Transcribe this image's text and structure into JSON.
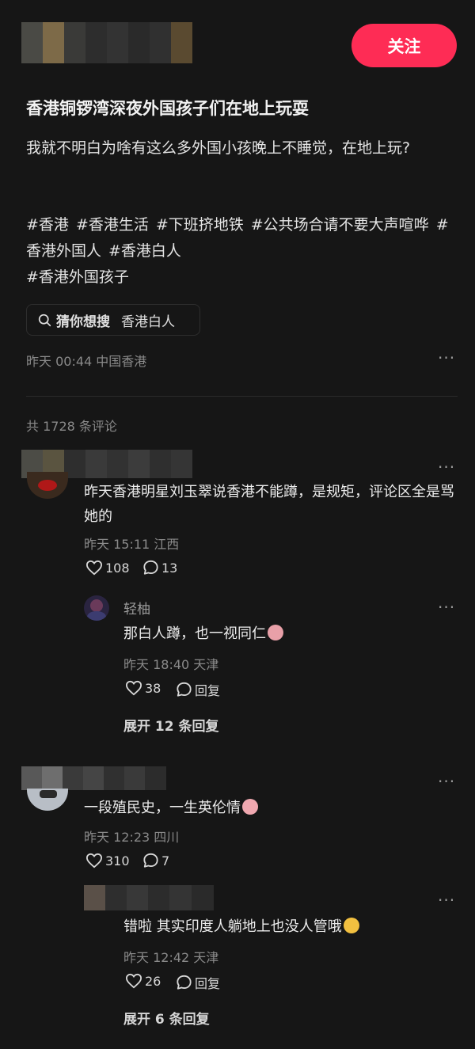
{
  "header": {
    "follow_label": "关注"
  },
  "post": {
    "title": "香港铜锣湾深夜外国孩子们在地上玩耍",
    "description": "我就不明白为啥有这么多外国小孩晚上不睡觉，在地上玩?",
    "hashtags": [
      "#香港",
      "#香港生活",
      "#下班挤地铁",
      "#公共场合请不要大声喧哗",
      "#香港外国人",
      "#香港白人",
      "#香港外国孩子"
    ],
    "search_guess_label": "猜你想搜",
    "search_keyword": "香港白人",
    "timestamp_location": "昨天 00:44 中国香港",
    "more_icon": "more-dots-icon"
  },
  "comments_header": {
    "count_text": "共 1728 条评论"
  },
  "comments": [
    {
      "text": "昨天香港明星刘玉翠说香港不能蹲，是规矩，评论区全是骂她的",
      "meta": "昨天 15:11 江西",
      "likes": "108",
      "replies": "13",
      "reply": {
        "username": "轻柚",
        "text": "那白人蹲，也一视同仁",
        "meta": "昨天 18:40 天津",
        "likes": "38",
        "reply_label": "回复"
      },
      "expand_label": "展开 12 条回复"
    },
    {
      "text": "一段殖民史，一生英伦情",
      "meta": "昨天 12:23 四川",
      "likes": "310",
      "replies": "7",
      "reply": {
        "username": "",
        "text": "错啦 其实印度人躺地上也没人管哦",
        "meta": "昨天 12:42 天津",
        "likes": "26",
        "reply_label": "回复"
      },
      "expand_label": "展开 6 条回复"
    }
  ],
  "colors": {
    "accent": "#fe2c55",
    "background": "#161616"
  }
}
